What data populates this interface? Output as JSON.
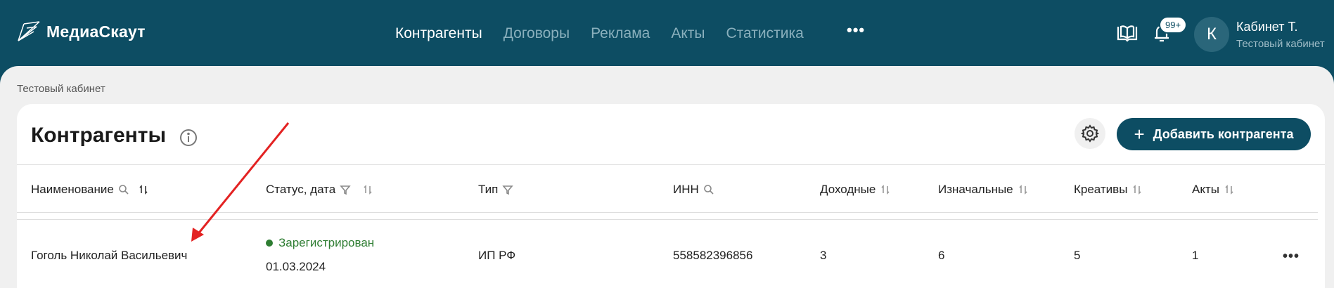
{
  "app": {
    "name": "МедиаСкаут"
  },
  "nav": {
    "items": [
      {
        "label": "Контрагенты",
        "active": true
      },
      {
        "label": "Договоры",
        "active": false
      },
      {
        "label": "Реклама",
        "active": false
      },
      {
        "label": "Акты",
        "active": false
      },
      {
        "label": "Статистика",
        "active": false
      }
    ],
    "more": "•••"
  },
  "header": {
    "notifications_badge": "99+",
    "avatar_letter": "К",
    "account_name": "Кабинет Т.",
    "account_sub": "Тестовый кабинет"
  },
  "breadcrumb": "Тестовый кабинет",
  "page": {
    "title": "Контрагенты",
    "add_button": "Добавить контрагента"
  },
  "table": {
    "columns": [
      "Наименование",
      "Статус, дата",
      "Тип",
      "ИНН",
      "Доходные",
      "Изначальные",
      "Креативы",
      "Акты"
    ],
    "rows": [
      {
        "name": "Гоголь Николай Васильевич",
        "status": "Зарегистрирован",
        "date": "01.03.2024",
        "type": "ИП РФ",
        "inn": "558582396856",
        "income": "3",
        "initial": "6",
        "creatives": "5",
        "acts": "1"
      }
    ]
  },
  "colors": {
    "header_bg": "#0d4d63",
    "status_green": "#2e7d32",
    "arrow_red": "#e32222"
  },
  "icons": [
    "logo-icon",
    "book-icon",
    "bell-icon",
    "info-icon",
    "gear-icon",
    "search-icon",
    "filter-icon",
    "sort-icon",
    "more-icon"
  ]
}
